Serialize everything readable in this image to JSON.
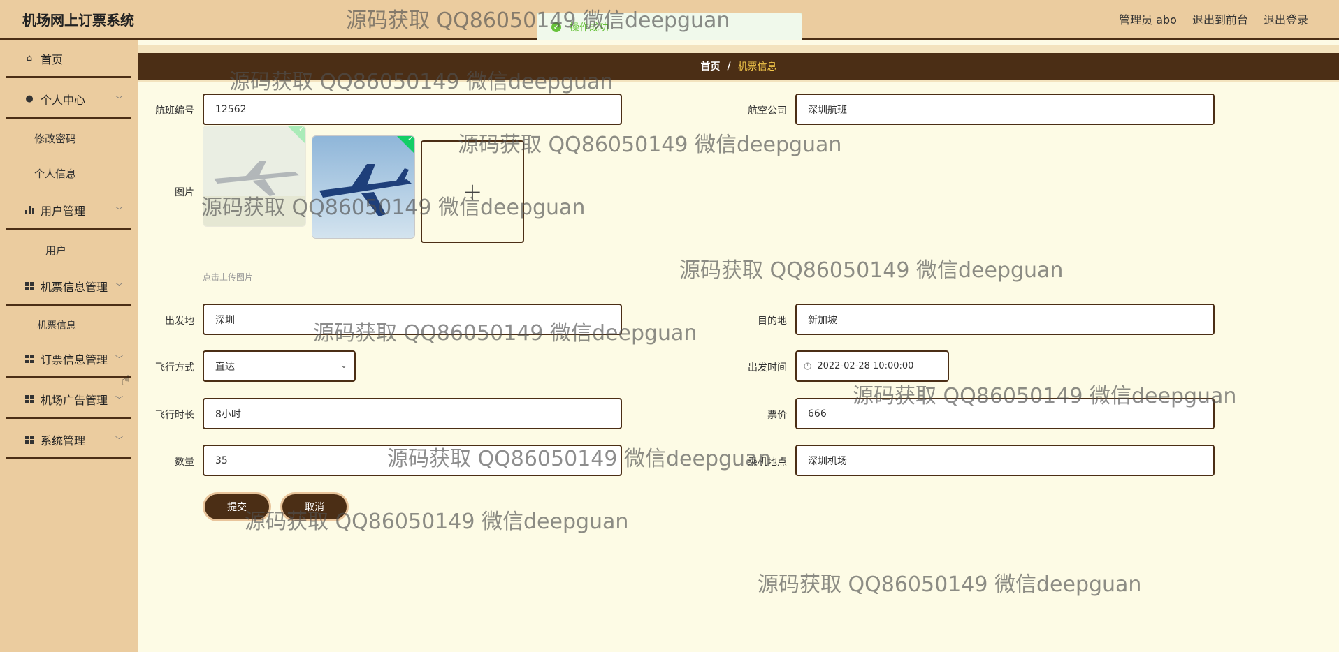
{
  "header": {
    "title": "机场网上订票系统",
    "admin_label": "管理员 abo",
    "frontend_link": "退出到前台",
    "logout_link": "退出登录"
  },
  "toast": {
    "message": "操作成功"
  },
  "sidebar": {
    "home": "首页",
    "personal_center": "个人中心",
    "change_password": "修改密码",
    "personal_info": "个人信息",
    "user_mgmt": "用户管理",
    "user": "用户",
    "ticket_mgmt": "机票信息管理",
    "ticket_info": "机票信息",
    "order_mgmt": "订票信息管理",
    "ad_mgmt": "机场广告管理",
    "system_mgmt": "系统管理"
  },
  "breadcrumb": {
    "home": "首页",
    "sep": "/",
    "current": "机票信息"
  },
  "form": {
    "flight_no_label": "航班编号",
    "flight_no": "12562",
    "airline_label": "航空公司",
    "airline": "深圳航班",
    "image_label": "图片",
    "upload_tip": "点击上传图片",
    "departure_label": "出发地",
    "departure": "深圳",
    "destination_label": "目的地",
    "destination": "新加坡",
    "flight_mode_label": "飞行方式",
    "flight_mode": "直达",
    "depart_time_label": "出发时间",
    "depart_time": "2022-02-28 10:00:00",
    "duration_label": "飞行时长",
    "duration": "8小时",
    "price_label": "票价",
    "price": "666",
    "quantity_label": "数量",
    "quantity": "35",
    "boarding_label": "乘机地点",
    "boarding": "深圳机场"
  },
  "buttons": {
    "submit": "提交",
    "cancel": "取消"
  },
  "watermark_text": "源码获取 QQ86050149 微信deepguan",
  "colors": {
    "accent": "#4b2e15",
    "sidebar": "#ebcc9f",
    "background": "#fdfbe5",
    "success": "#67c23a"
  }
}
